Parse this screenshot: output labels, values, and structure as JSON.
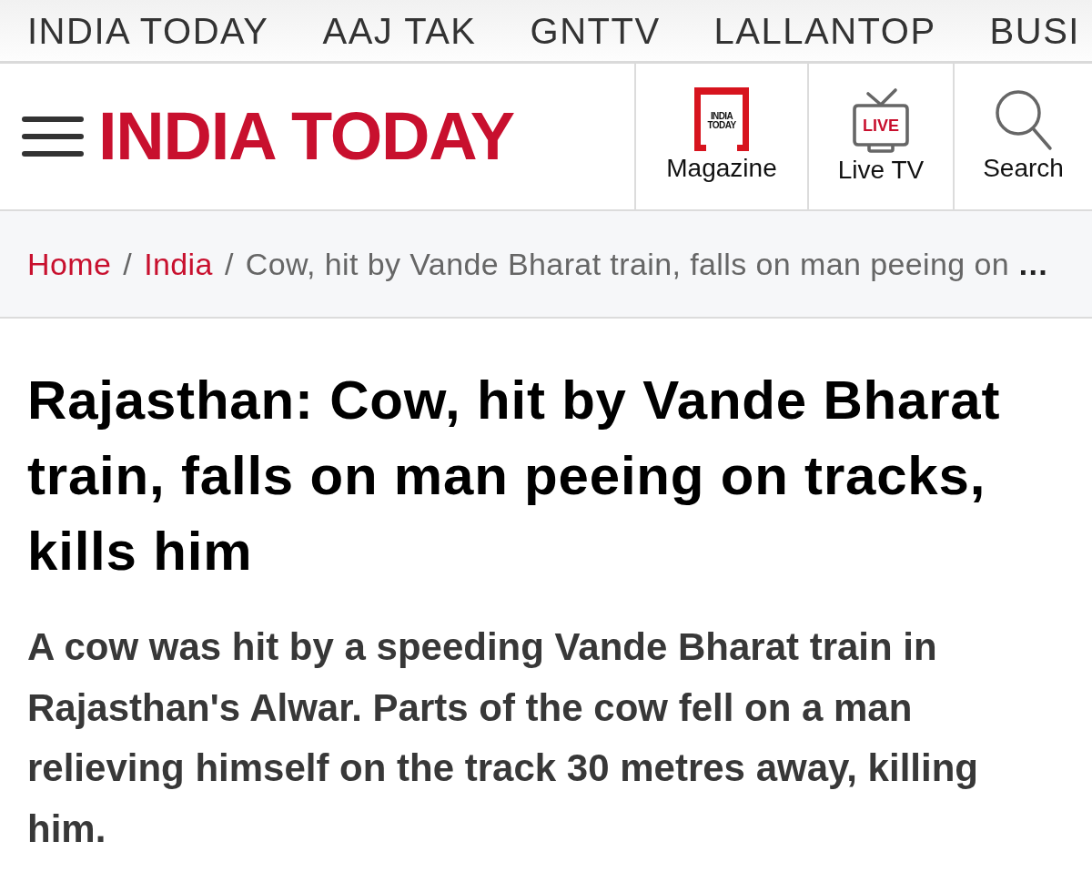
{
  "top_nav": {
    "items": [
      "INDIA TODAY",
      "AAJ TAK",
      "GNTTV",
      "LALLANTOP",
      "BUSI"
    ]
  },
  "header": {
    "logo": "INDIA TODAY",
    "actions": [
      {
        "kind": "magazine",
        "label": "Magazine",
        "icon_text": "INDIA TODAY"
      },
      {
        "kind": "live_tv",
        "label": "Live TV",
        "icon_text": "LIVE"
      },
      {
        "kind": "search",
        "label": "Search"
      }
    ]
  },
  "breadcrumb": {
    "items": [
      {
        "kind": "link",
        "text": "Home"
      },
      {
        "kind": "separator",
        "text": "/"
      },
      {
        "kind": "link",
        "text": "India"
      },
      {
        "kind": "separator",
        "text": "/"
      },
      {
        "kind": "current",
        "text": "Cow, hit by Vande Bharat train, falls on man peeing on"
      },
      {
        "kind": "ellipsis",
        "text": "…"
      }
    ]
  },
  "article": {
    "headline": "Rajasthan: Cow, hit by Vande Bharat train, falls on man peeing on tracks, kills him",
    "summary": "A cow was hit by a speeding Vande Bharat train in Rajasthan's Alwar. Parts of the cow fell on a man relieving himself on the track 30 metres away, killing him."
  }
}
